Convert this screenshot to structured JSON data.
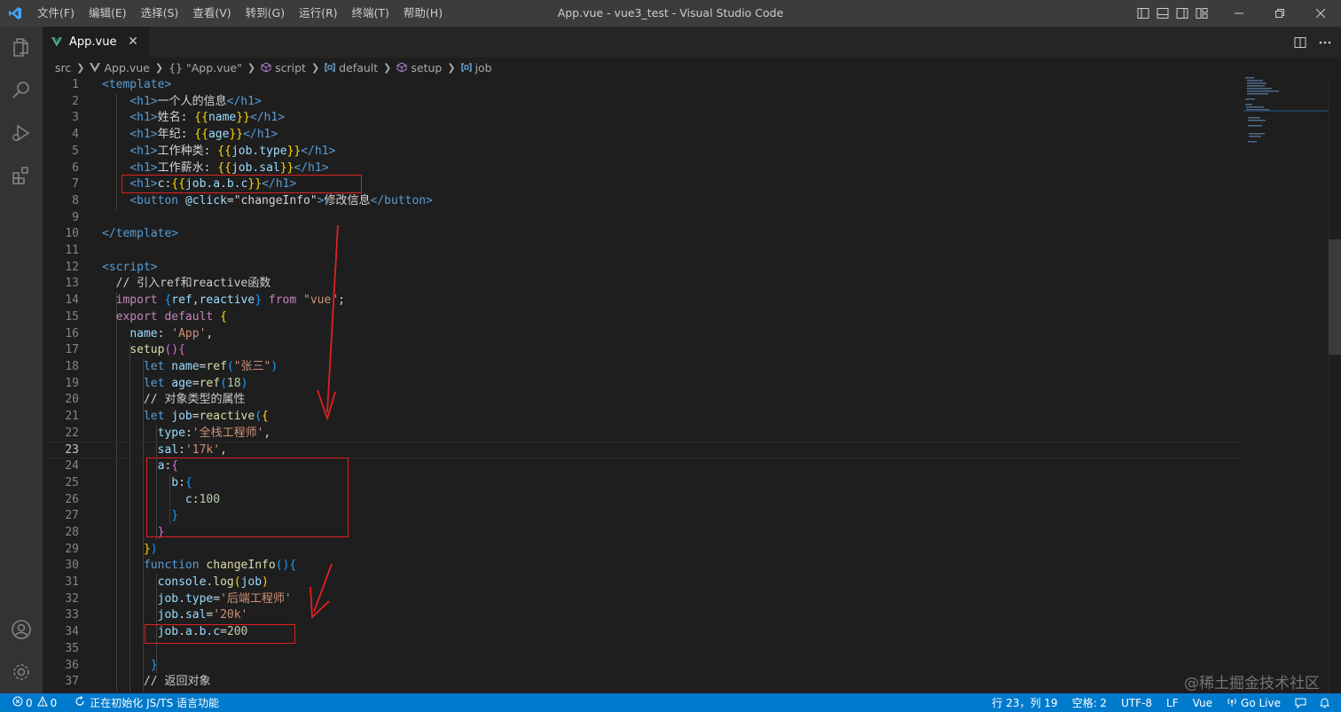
{
  "titlebar": {
    "menu": [
      "文件(F)",
      "编辑(E)",
      "选择(S)",
      "查看(V)",
      "转到(G)",
      "运行(R)",
      "终端(T)",
      "帮助(H)"
    ],
    "window_title": "App.vue - vue3_test - Visual Studio Code"
  },
  "activity_bar": {
    "icons": [
      "explorer-icon",
      "search-icon",
      "run-debug-icon",
      "extensions-icon",
      "account-icon",
      "settings-gear-icon"
    ]
  },
  "tabs": [
    {
      "label": "App.vue",
      "icon": "vue-icon",
      "active": true
    }
  ],
  "breadcrumb": {
    "items": [
      "src",
      "App.vue",
      "{} \"App.vue\"",
      "script",
      "default",
      "setup",
      "job"
    ]
  },
  "editor": {
    "current_line": 23,
    "lines": [
      {
        "n": "1",
        "tokens": [
          [
            "tag",
            "<template>"
          ]
        ]
      },
      {
        "n": "2",
        "tokens": [
          [
            "text",
            "    "
          ],
          [
            "tag",
            "<h1>"
          ],
          [
            "text",
            "一个人的信息"
          ],
          [
            "tag",
            "</h1>"
          ]
        ]
      },
      {
        "n": "3",
        "tokens": [
          [
            "text",
            "    "
          ],
          [
            "tag",
            "<h1>"
          ],
          [
            "text",
            "姓名: "
          ],
          [
            "brace",
            "{{"
          ],
          [
            "var",
            "name"
          ],
          [
            "brace",
            "}}"
          ],
          [
            "tag",
            "</h1>"
          ]
        ]
      },
      {
        "n": "4",
        "tokens": [
          [
            "text",
            "    "
          ],
          [
            "tag",
            "<h1>"
          ],
          [
            "text",
            "年纪: "
          ],
          [
            "brace",
            "{{"
          ],
          [
            "var",
            "age"
          ],
          [
            "brace",
            "}}"
          ],
          [
            "tag",
            "</h1>"
          ]
        ]
      },
      {
        "n": "5",
        "tokens": [
          [
            "text",
            "    "
          ],
          [
            "tag",
            "<h1>"
          ],
          [
            "text",
            "工作种类: "
          ],
          [
            "brace",
            "{{"
          ],
          [
            "var",
            "job.type"
          ],
          [
            "brace",
            "}}"
          ],
          [
            "tag",
            "</h1>"
          ]
        ]
      },
      {
        "n": "6",
        "tokens": [
          [
            "text",
            "    "
          ],
          [
            "tag",
            "<h1>"
          ],
          [
            "text",
            "工作薪水: "
          ],
          [
            "brace",
            "{{"
          ],
          [
            "var",
            "job.sal"
          ],
          [
            "brace",
            "}}"
          ],
          [
            "tag",
            "</h1>"
          ]
        ]
      },
      {
        "n": "7",
        "tokens": [
          [
            "text",
            "    "
          ],
          [
            "tag",
            "<h1>"
          ],
          [
            "text",
            "c:"
          ],
          [
            "brace",
            "{{"
          ],
          [
            "var",
            "job.a.b.c"
          ],
          [
            "brace",
            "}}"
          ],
          [
            "tag",
            "</h1>"
          ]
        ]
      },
      {
        "n": "8",
        "tokens": [
          [
            "text",
            "    "
          ],
          [
            "tag",
            "<button "
          ],
          [
            "attr",
            "@click"
          ],
          [
            "text",
            "="
          ],
          [
            "text",
            "\"changeInfo\""
          ],
          [
            "tag",
            ">"
          ],
          [
            "text",
            "修改信息"
          ],
          [
            "tag",
            "</button>"
          ]
        ]
      },
      {
        "n": "9",
        "tokens": []
      },
      {
        "n": "10",
        "tokens": [
          [
            "tag",
            "</template>"
          ]
        ]
      },
      {
        "n": "11",
        "tokens": []
      },
      {
        "n": "12",
        "tokens": [
          [
            "tag",
            "<script>"
          ]
        ]
      },
      {
        "n": "13",
        "tokens": [
          [
            "text",
            "  "
          ],
          [
            "cmt",
            "// 引入ref和reactive函数"
          ]
        ]
      },
      {
        "n": "14",
        "tokens": [
          [
            "text",
            "  "
          ],
          [
            "kw2",
            "import "
          ],
          [
            "brace3",
            "{"
          ],
          [
            "var",
            "ref"
          ],
          [
            "text",
            ","
          ],
          [
            "var",
            "reactive"
          ],
          [
            "brace3",
            "}"
          ],
          [
            "kw2",
            " from "
          ],
          [
            "str",
            "\"vue\""
          ],
          [
            "text",
            ";"
          ]
        ]
      },
      {
        "n": "15",
        "tokens": [
          [
            "text",
            "  "
          ],
          [
            "kw2",
            "export default "
          ],
          [
            "brace",
            "{"
          ]
        ]
      },
      {
        "n": "16",
        "tokens": [
          [
            "text",
            "    "
          ],
          [
            "var",
            "name"
          ],
          [
            "text",
            ": "
          ],
          [
            "str",
            "'App'"
          ],
          [
            "text",
            ","
          ]
        ]
      },
      {
        "n": "17",
        "tokens": [
          [
            "text",
            "    "
          ],
          [
            "fn",
            "setup"
          ],
          [
            "brace2",
            "()"
          ],
          [
            "brace2",
            "{"
          ]
        ]
      },
      {
        "n": "18",
        "tokens": [
          [
            "text",
            "      "
          ],
          [
            "kw",
            "let "
          ],
          [
            "var",
            "name"
          ],
          [
            "text",
            "="
          ],
          [
            "fn",
            "ref"
          ],
          [
            "brace3",
            "("
          ],
          [
            "str",
            "\"张三\""
          ],
          [
            "brace3",
            ")"
          ]
        ]
      },
      {
        "n": "19",
        "tokens": [
          [
            "text",
            "      "
          ],
          [
            "kw",
            "let "
          ],
          [
            "var",
            "age"
          ],
          [
            "text",
            "="
          ],
          [
            "fn",
            "ref"
          ],
          [
            "brace3",
            "("
          ],
          [
            "num",
            "18"
          ],
          [
            "brace3",
            ")"
          ]
        ]
      },
      {
        "n": "20",
        "tokens": [
          [
            "text",
            "      "
          ],
          [
            "cmt",
            "// 对象类型的属性"
          ]
        ]
      },
      {
        "n": "21",
        "tokens": [
          [
            "text",
            "      "
          ],
          [
            "kw",
            "let "
          ],
          [
            "var",
            "job"
          ],
          [
            "text",
            "="
          ],
          [
            "fn",
            "reactive"
          ],
          [
            "brace3",
            "("
          ],
          [
            "brace",
            "{"
          ]
        ]
      },
      {
        "n": "22",
        "tokens": [
          [
            "text",
            "        "
          ],
          [
            "var",
            "type"
          ],
          [
            "text",
            ":"
          ],
          [
            "str",
            "'全栈工程师'"
          ],
          [
            "text",
            ","
          ]
        ]
      },
      {
        "n": "23",
        "tokens": [
          [
            "text",
            "        "
          ],
          [
            "var",
            "sal"
          ],
          [
            "text",
            ":"
          ],
          [
            "str",
            "'17k'"
          ],
          [
            "text",
            ","
          ]
        ]
      },
      {
        "n": "24",
        "tokens": [
          [
            "text",
            "        "
          ],
          [
            "var",
            "a"
          ],
          [
            "text",
            ":"
          ],
          [
            "brace2",
            "{"
          ]
        ]
      },
      {
        "n": "25",
        "tokens": [
          [
            "text",
            "          "
          ],
          [
            "var",
            "b"
          ],
          [
            "text",
            ":"
          ],
          [
            "brace3",
            "{"
          ]
        ]
      },
      {
        "n": "26",
        "tokens": [
          [
            "text",
            "            "
          ],
          [
            "var",
            "c"
          ],
          [
            "text",
            ":"
          ],
          [
            "num",
            "100"
          ]
        ]
      },
      {
        "n": "27",
        "tokens": [
          [
            "text",
            "          "
          ],
          [
            "brace3",
            "}"
          ]
        ]
      },
      {
        "n": "28",
        "tokens": [
          [
            "text",
            "        "
          ],
          [
            "brace2",
            "}"
          ]
        ]
      },
      {
        "n": "29",
        "tokens": [
          [
            "text",
            "      "
          ],
          [
            "brace",
            "}"
          ],
          [
            "brace3",
            ")"
          ]
        ]
      },
      {
        "n": "30",
        "tokens": [
          [
            "text",
            "      "
          ],
          [
            "kw",
            "function "
          ],
          [
            "fn",
            "changeInfo"
          ],
          [
            "brace3",
            "()"
          ],
          [
            "brace3",
            "{"
          ]
        ]
      },
      {
        "n": "31",
        "tokens": [
          [
            "text",
            "        "
          ],
          [
            "var",
            "console"
          ],
          [
            "text",
            "."
          ],
          [
            "fn",
            "log"
          ],
          [
            "brace",
            "("
          ],
          [
            "var",
            "job"
          ],
          [
            "brace",
            ")"
          ]
        ]
      },
      {
        "n": "32",
        "tokens": [
          [
            "text",
            "        "
          ],
          [
            "var",
            "job"
          ],
          [
            "text",
            "."
          ],
          [
            "var",
            "type"
          ],
          [
            "text",
            "="
          ],
          [
            "str",
            "'后端工程师'"
          ]
        ]
      },
      {
        "n": "33",
        "tokens": [
          [
            "text",
            "        "
          ],
          [
            "var",
            "job"
          ],
          [
            "text",
            "."
          ],
          [
            "var",
            "sal"
          ],
          [
            "text",
            "="
          ],
          [
            "str",
            "'20k'"
          ]
        ]
      },
      {
        "n": "34",
        "tokens": [
          [
            "text",
            "        "
          ],
          [
            "var",
            "job"
          ],
          [
            "text",
            "."
          ],
          [
            "var",
            "a"
          ],
          [
            "text",
            "."
          ],
          [
            "var",
            "b"
          ],
          [
            "text",
            "."
          ],
          [
            "var",
            "c"
          ],
          [
            "text",
            "="
          ],
          [
            "num",
            "200"
          ]
        ]
      },
      {
        "n": "35",
        "tokens": []
      },
      {
        "n": "36",
        "tokens": [
          [
            "text",
            "       "
          ],
          [
            "brace3",
            "}"
          ]
        ]
      },
      {
        "n": "37",
        "tokens": [
          [
            "text",
            "      "
          ],
          [
            "cmt",
            "// 返回对象"
          ]
        ]
      }
    ]
  },
  "watermark": "@稀土掘金技术社区",
  "statusbar": {
    "errors": "0",
    "warnings": "0",
    "task": "正在初始化 JS/TS 语言功能",
    "cursor": "行 23，列 19",
    "spaces": "空格: 2",
    "encoding": "UTF-8",
    "eol": "LF",
    "language": "Vue",
    "golive": "Go Live"
  },
  "colors": {
    "accent": "#007acc",
    "annotation": "#e02020"
  }
}
